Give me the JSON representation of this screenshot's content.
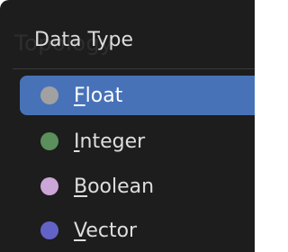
{
  "menu": {
    "ghost_title": "Topology",
    "header": "Data Type",
    "items": [
      {
        "mnemonic": "F",
        "rest": "loat",
        "color": "#a1a1a1",
        "selected": true
      },
      {
        "mnemonic": "I",
        "rest": "nteger",
        "color": "#5b8f5b",
        "selected": false
      },
      {
        "mnemonic": "B",
        "rest": "oolean",
        "color": "#cba6d6",
        "selected": false
      },
      {
        "mnemonic": "V",
        "rest": "ector",
        "color": "#6363c7",
        "selected": false
      }
    ]
  },
  "colors": {
    "menu_background": "#1d1d1d",
    "selection": "#4872b8"
  }
}
